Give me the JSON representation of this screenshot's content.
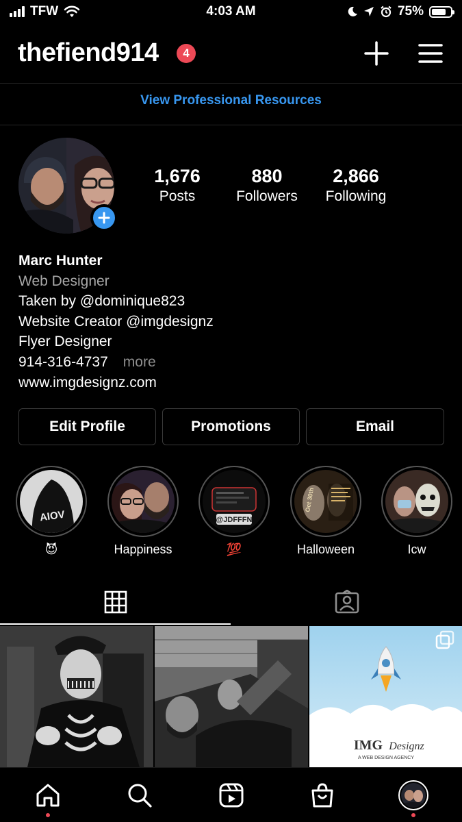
{
  "status_bar": {
    "carrier": "TFW",
    "time": "4:03 AM",
    "battery_percent": "75%",
    "battery_level": 0.75
  },
  "header": {
    "username": "thefiend914",
    "notification_count": "4"
  },
  "professional_link": "View Professional Resources",
  "stats": {
    "posts": {
      "value": "1,676",
      "label": "Posts"
    },
    "followers": {
      "value": "880",
      "label": "Followers"
    },
    "following": {
      "value": "2,866",
      "label": "Following"
    }
  },
  "bio": {
    "name": "Marc Hunter",
    "category": "Web Designer",
    "line1": "Taken by @dominique823",
    "line2": "Website Creator @imgdesignz",
    "line3": "Flyer Designer",
    "phone": "914-316-4737",
    "more": "more",
    "website": "www.imgdesignz.com"
  },
  "actions": {
    "edit_profile": "Edit Profile",
    "promotions": "Promotions",
    "email": "Email"
  },
  "highlights": [
    {
      "label": "😈"
    },
    {
      "label": "Happiness"
    },
    {
      "label": "💯"
    },
    {
      "label": "Halloween"
    },
    {
      "label": "Icw"
    }
  ],
  "highlight_overlays": {
    "hoodie": "AIOV",
    "handle": "@JDFFFN",
    "flyer_date": "Oct 30th"
  },
  "grid_overlays": {
    "img_logo": "IMG",
    "img_logo_script": "Designz",
    "img_tagline": "A WEB DESIGN AGENCY"
  },
  "colors": {
    "accent_blue": "#3897f0",
    "badge_red": "#ed4956",
    "background": "#000000",
    "border": "#3a3a3a"
  }
}
